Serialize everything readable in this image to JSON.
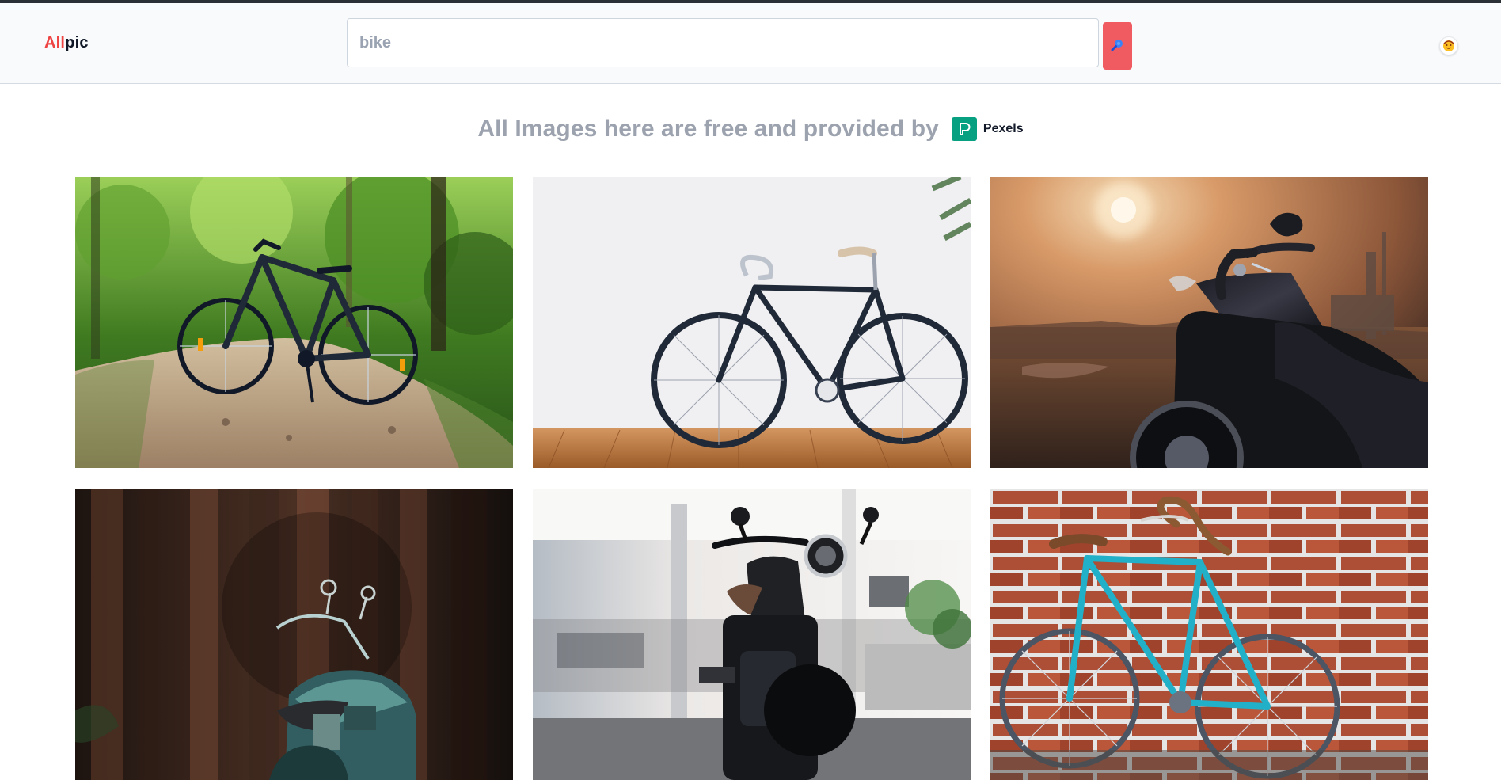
{
  "header": {
    "logo_part_a": "All",
    "logo_part_b": "pic",
    "search": {
      "value": "bike",
      "placeholder": "bike"
    },
    "search_button_icon": "search-icon",
    "avatar_icon": "user-avatar-icon"
  },
  "banner": {
    "text": "All Images here are free and provided by",
    "provider_name": "Pexels",
    "provider_icon": "pexels-logo-icon"
  },
  "gallery": {
    "images": [
      {
        "subject": "mountain-bike-on-forest-path"
      },
      {
        "subject": "fixed-gear-bike-against-white-wall"
      },
      {
        "subject": "cruiser-motorcycle-at-sunset"
      },
      {
        "subject": "teal-motorcycle-in-dark-forest"
      },
      {
        "subject": "black-scrambler-motorcycle-garage"
      },
      {
        "subject": "blue-road-bike-against-brick-wall"
      }
    ]
  },
  "colors": {
    "brand_red": "#ef4444",
    "search_button": "#f05a61",
    "pexels_green": "#07a081",
    "banner_text": "#9ca3af"
  }
}
